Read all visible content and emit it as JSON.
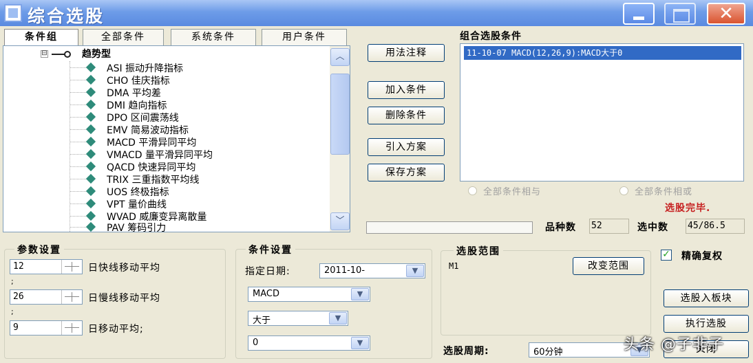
{
  "window": {
    "title": "综合选股",
    "close_glyph": "✕"
  },
  "tabs": [
    "条件组",
    "全部条件",
    "系统条件",
    "用户条件"
  ],
  "tree": {
    "expander": "⊟",
    "root_label": "趋势型",
    "items": [
      "ASI 振动升降指标",
      "CHO 佳庆指标",
      "DMA 平均差",
      "DMI 趋向指标",
      "DPO 区间震荡线",
      "EMV 简易波动指标",
      "MACD 平滑异同平均",
      "VMACD 量平滑异同平均",
      "QACD 快速异同平均",
      "TRIX 三重指数平均线",
      "UOS 终极指标",
      "VPT 量价曲线",
      "WVAD 威廉变异离散量",
      "PAV 筹码引力"
    ],
    "scroll_up": "︿",
    "scroll_down": "﹀"
  },
  "middle_buttons": {
    "usage": "用法注释",
    "add": "加入条件",
    "delete": "删除条件",
    "import": "引入方案",
    "save": "保存方案"
  },
  "combo_list": {
    "title": "组合选股条件",
    "selected_item": "11-10-07 MACD(12,26,9):MACD大于0"
  },
  "radios": {
    "all_and": "全部条件相与",
    "all_or": "全部条件相或"
  },
  "status_text": "选股完毕.",
  "stats": {
    "count_label": "品种数",
    "count_value": "52",
    "selected_label": "选中数",
    "selected_value": "45/86.5"
  },
  "param_settings": {
    "title": "参数设置",
    "params": [
      {
        "value": "12",
        "label": "日快线移动平均"
      },
      {
        "value": "26",
        "label": "日慢线移动平均"
      },
      {
        "value": "9",
        "label": "日移动平均;"
      }
    ],
    "separator": ";"
  },
  "condition_settings": {
    "title": "条件设置",
    "date_label": "指定日期:",
    "date_value": "2011-10-",
    "indicator": "MACD",
    "operator": "大于",
    "value": "0",
    "dropdown_glyph": "▼"
  },
  "range": {
    "title": "选股范围",
    "value": "M1",
    "change_button": "改变范围"
  },
  "options": {
    "precise_rights_label": "精确复权",
    "precise_rights_checked": true,
    "check_glyph": "✓"
  },
  "period": {
    "label": "选股周期:",
    "value": "60分钟"
  },
  "action_buttons": {
    "to_block": "选股入板块",
    "execute": "执行选股",
    "close": "关闭"
  },
  "watermark": "头条 @子非子"
}
